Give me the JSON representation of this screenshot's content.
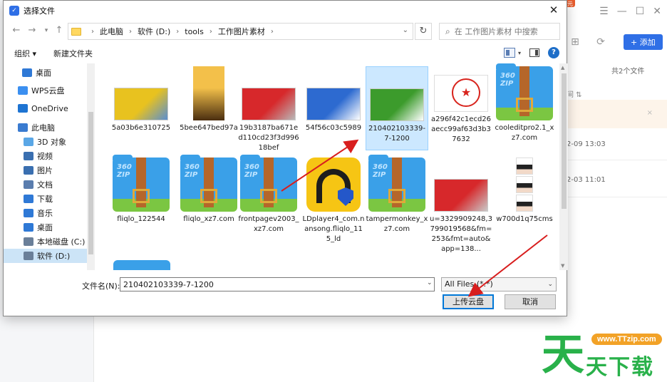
{
  "dialog": {
    "title": "选择文件",
    "breadcrumbs": [
      "此电脑",
      "软件 (D:)",
      "tools",
      "工作图片素材"
    ],
    "search_placeholder": "在 工作图片素材 中搜索",
    "organize_label": "组织 ▾",
    "new_folder_label": "新建文件夹",
    "help_label": "?",
    "filename_label": "文件名(N):",
    "filename_value": "210402103339-7-1200",
    "filter_value": "All Files (*.*)",
    "upload_label": "上传云盘",
    "cancel_label": "取消"
  },
  "nav": {
    "items": [
      {
        "label": "桌面",
        "icon": "desktop-icon",
        "color": "#2f79d6"
      },
      {
        "label": "WPS云盘",
        "icon": "cloud-icon",
        "color": "#3b8ff0"
      },
      {
        "label": "OneDrive",
        "icon": "onedrive-icon",
        "color": "#1e74d2"
      },
      {
        "label": "此电脑",
        "icon": "computer-icon",
        "color": "#3a7bd0"
      },
      {
        "label": "3D 对象",
        "icon": "3d-objects-icon",
        "color": "#5aa7e6"
      },
      {
        "label": "视频",
        "icon": "video-icon",
        "color": "#3a6fb0"
      },
      {
        "label": "图片",
        "icon": "pictures-icon",
        "color": "#3a6fb0"
      },
      {
        "label": "文档",
        "icon": "documents-icon",
        "color": "#5a7dae"
      },
      {
        "label": "下载",
        "icon": "download-icon",
        "color": "#2f79d6"
      },
      {
        "label": "音乐",
        "icon": "music-icon",
        "color": "#2f79d6"
      },
      {
        "label": "桌面",
        "icon": "desktop-icon",
        "color": "#2f79d6"
      },
      {
        "label": "本地磁盘 (C:)",
        "icon": "drive-icon",
        "color": "#6a7f99"
      },
      {
        "label": "软件 (D:)",
        "icon": "drive-icon",
        "color": "#6a7f99"
      }
    ]
  },
  "files": [
    {
      "label": "5a03b6e310725",
      "type": "photo",
      "colors": [
        "#e8c21f",
        "#5a8ed0"
      ]
    },
    {
      "label": "5bee647bed97a",
      "type": "photo-tall",
      "colors": [
        "#f3c04a",
        "#4a2e10"
      ]
    },
    {
      "label": "19b3187ba671ed110cd23f3d99618bef",
      "type": "photo",
      "colors": [
        "#d7282b",
        "#b9b9b9"
      ]
    },
    {
      "label": "54f56c03c5989",
      "type": "photo",
      "colors": [
        "#2d6ad0",
        "#ffffff"
      ]
    },
    {
      "label": "210402103339-7-1200",
      "type": "photo",
      "colors": [
        "#3c9b2c",
        "#ffffff"
      ]
    },
    {
      "label": "a296f42c1ecd26aecc99af63d3b37632",
      "type": "stamp",
      "colors": [
        "#ffffff",
        "#d8241d"
      ]
    },
    {
      "label": "cooleditpro2.1_xz7.com",
      "type": "zip"
    },
    {
      "label": "fliqlo_122544",
      "type": "zip"
    },
    {
      "label": "fliqlo_xz7.com",
      "type": "zip"
    },
    {
      "label": "frontpagev2003_xz7.com",
      "type": "zip"
    },
    {
      "label": "LDplayer4_com.nansong.fliqlo_115_ld",
      "type": "app"
    },
    {
      "label": "tampermonkey_xz7.com",
      "type": "zip"
    },
    {
      "label": "u=3329909248,3799019568&fm=253&fmt=auto&app=138...",
      "type": "photo",
      "colors": [
        "#d7282b",
        "#c9c9c9"
      ]
    },
    {
      "label": "w700d1q75cms",
      "type": "portraits"
    }
  ],
  "background_app": {
    "add_label": "+ 添加",
    "count_label": "共2个文件",
    "sort_label": "间 ⇅",
    "banner_close": "×",
    "dates": [
      "2-09 13:03",
      "2-03 11:01"
    ],
    "badge": "元"
  },
  "watermark": {
    "url": "www.TTzip.com",
    "big": "天",
    "sub": "天下载"
  },
  "colors": {
    "accent": "#2f6fe6",
    "selection": "#cce8ff",
    "annotation_arrow": "#d81e1e"
  }
}
